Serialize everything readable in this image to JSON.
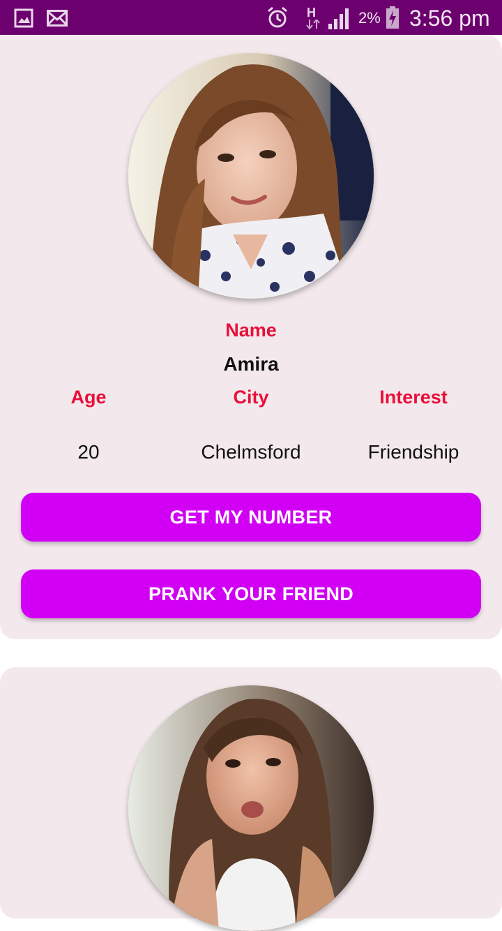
{
  "status_bar": {
    "battery_percent": "2%",
    "time": "3:56 pm",
    "network_label": "H",
    "icons": [
      "gallery-icon",
      "mail-icon",
      "alarm-icon",
      "network-h-icon",
      "signal-icon",
      "battery-charging-icon"
    ],
    "background": "#6d006f"
  },
  "profiles": [
    {
      "name_label": "Name",
      "name": "Amira",
      "age_label": "Age",
      "city_label": "City",
      "interest_label": "Interest",
      "age": "20",
      "city": "Chelmsford",
      "interest": "Friendship",
      "primary_button": "GET MY NUMBER",
      "secondary_button": "PRANK YOUR FRIEND"
    },
    {
      "photo": "profile-photo"
    }
  ],
  "colors": {
    "accent_label": "#e8103a",
    "button": "#d100f5",
    "card_background": "#f3e9ec"
  }
}
